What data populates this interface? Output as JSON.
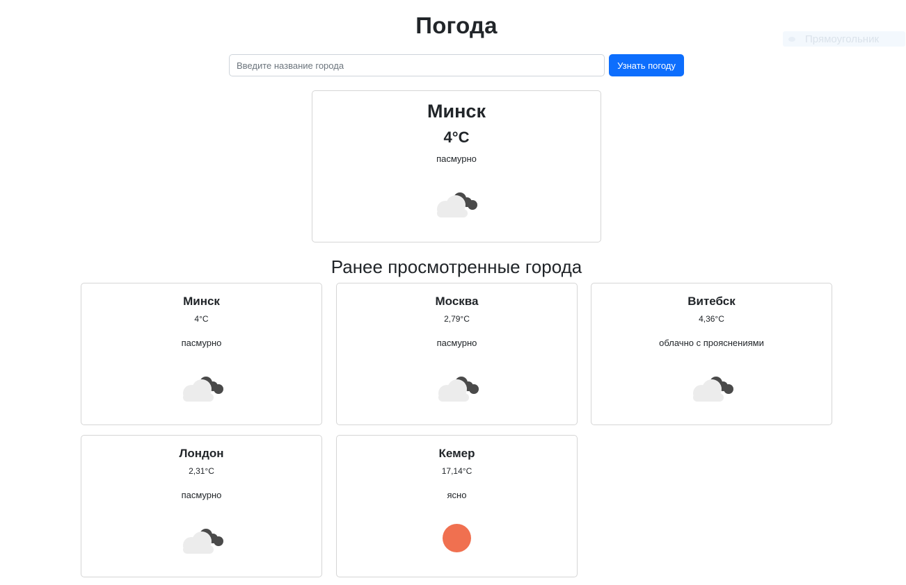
{
  "header": {
    "title": "Погода"
  },
  "overlay": {
    "label": "Прямоугольник"
  },
  "search": {
    "placeholder": "Введите название города",
    "value": "",
    "button_label": "Узнать погоду"
  },
  "current": {
    "city": "Минск",
    "temp": "4°C",
    "description": "пасмурно",
    "icon": "overcast-cloud-icon"
  },
  "recent": {
    "title": "Ранее просмотренные города",
    "cities": [
      {
        "city": "Минск",
        "temp": "4°C",
        "description": "пасмурно",
        "icon": "overcast-cloud-icon"
      },
      {
        "city": "Москва",
        "temp": "2,79°C",
        "description": "пасмурно",
        "icon": "overcast-cloud-icon"
      },
      {
        "city": "Витебск",
        "temp": "4,36°C",
        "description": "облачно с прояснениями",
        "icon": "overcast-cloud-icon"
      },
      {
        "city": "Лондон",
        "temp": "2,31°C",
        "description": "пасмурно",
        "icon": "overcast-cloud-icon"
      },
      {
        "city": "Кемер",
        "temp": "17,14°C",
        "description": "ясно",
        "icon": "sun-icon"
      }
    ]
  },
  "colors": {
    "primary": "#0d6efd",
    "sun": "#f07050",
    "cloud_light": "#ececec",
    "cloud_dark": "#4a4a4a"
  }
}
